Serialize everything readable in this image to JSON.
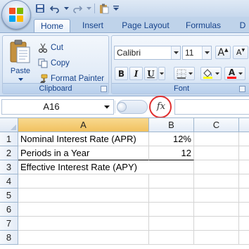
{
  "ribbon_tabs": [
    "Home",
    "Insert",
    "Page Layout",
    "Formulas",
    "D"
  ],
  "clipboard": {
    "paste_label": "Paste",
    "cut_label": "Cut",
    "copy_label": "Copy",
    "format_painter_label": "Format Painter",
    "group_label": "Clipboard"
  },
  "font": {
    "font_name": "Calibri",
    "font_size": "11",
    "bold": "B",
    "italic": "I",
    "underline": "U",
    "grow": "A",
    "shrink": "A",
    "font_color_letter": "A",
    "group_label": "Font"
  },
  "formula_bar": {
    "name_box": "A16",
    "fx": "fx",
    "formula": ""
  },
  "sheet": {
    "columns": [
      "A",
      "B",
      "C"
    ],
    "rows": [
      "1",
      "2",
      "3",
      "4",
      "5",
      "6",
      "7",
      "8"
    ],
    "cells": {
      "A1": "Nominal Interest Rate (APR)",
      "B1": "12%",
      "A2": "Periods in a Year",
      "B2": "12",
      "A3": "Effective Interest Rate (APY)"
    }
  },
  "colors": {
    "accent_blue": "#15428b",
    "fx_highlight": "#e03030",
    "selected_column": "#f1c15f"
  }
}
